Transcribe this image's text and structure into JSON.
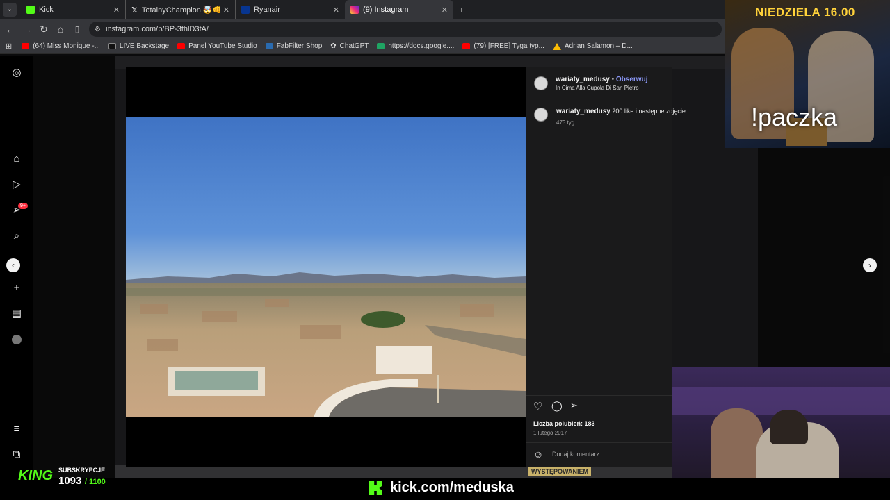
{
  "browser": {
    "tabs": [
      {
        "label": "Kick",
        "active": false
      },
      {
        "label": "TotalnyChampion 🤯👊 w serw",
        "active": false
      },
      {
        "label": "Ryanair",
        "active": false
      },
      {
        "label": "(9) Instagram",
        "active": true
      }
    ],
    "url": "instagram.com/p/BP-3thlD3fA/",
    "bookmarks": [
      "(64) Miss Monique -...",
      "LIVE Backstage",
      "Panel YouTube Studio",
      "FabFilter Shop",
      "ChatGPT",
      "https://docs.google....",
      "(79) [FREE] Tyga typ...",
      "Adrian Salamon – D..."
    ]
  },
  "instagram": {
    "sidebar_badge": "9+",
    "post": {
      "username": "wariaty_medusy",
      "separator": "•",
      "follow_label": "Obserwuj",
      "location": "In Cima Alla Cupola Di San Pietro",
      "caption_user": "wariaty_medusy",
      "caption_text": "200 like i następne zdjęcie...",
      "caption_age": "473 tyg.",
      "likes": "Liczba polubień: 183",
      "date": "1 lutego 2017",
      "comment_placeholder": "Dodaj komentarz..."
    }
  },
  "stream": {
    "promo_title": "NIEDZIELA 16.00",
    "promo_command": "!paczka",
    "subs_label": "SUBSKRYPCJE",
    "subs_current": "1093",
    "subs_goal": "/ 1100",
    "kick_url": "kick.com/meduska",
    "banner_text": "WYSTĘPOWANIEM",
    "brand_color": "#53fc18"
  }
}
